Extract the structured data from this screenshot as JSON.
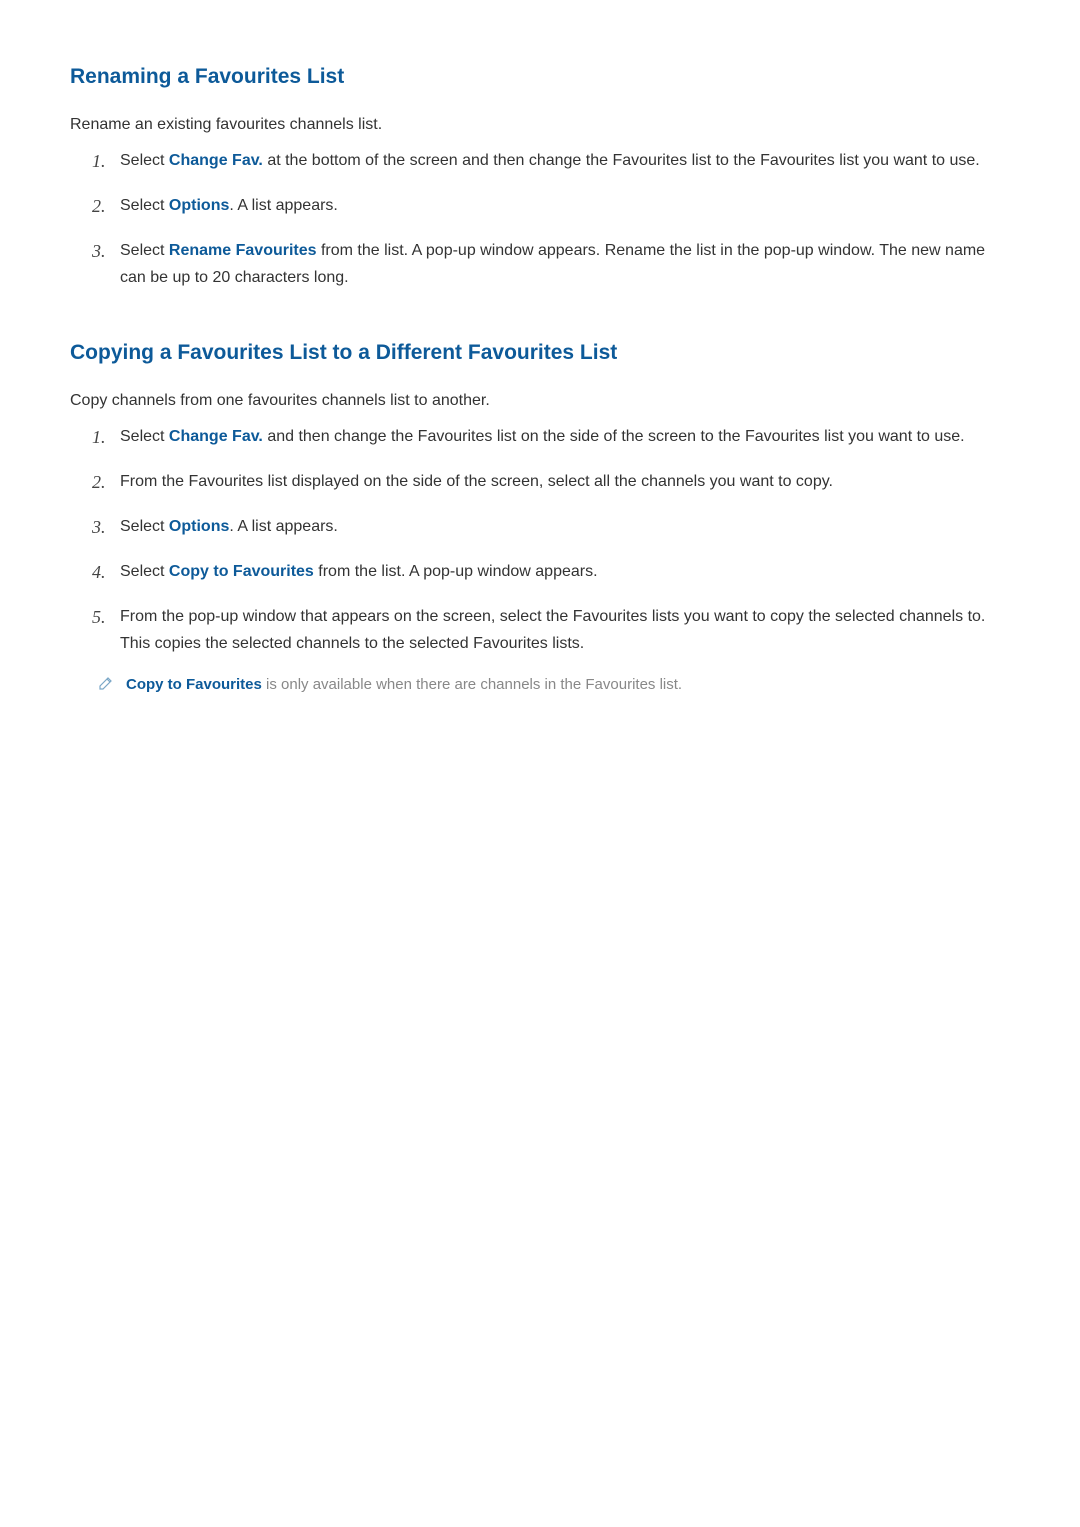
{
  "section1": {
    "heading": "Renaming a Favourites List",
    "intro": "Rename an existing favourites channels list.",
    "items": [
      {
        "number": "1.",
        "parts": [
          {
            "t": "Select ",
            "h": false
          },
          {
            "t": "Change Fav.",
            "h": true
          },
          {
            "t": " at the bottom of the screen and then change the Favourites list to the Favourites list you want to use.",
            "h": false
          }
        ]
      },
      {
        "number": "2.",
        "parts": [
          {
            "t": "Select ",
            "h": false
          },
          {
            "t": "Options",
            "h": true
          },
          {
            "t": ". A list appears.",
            "h": false
          }
        ]
      },
      {
        "number": "3.",
        "parts": [
          {
            "t": "Select ",
            "h": false
          },
          {
            "t": "Rename Favourites",
            "h": true
          },
          {
            "t": " from the list. A pop-up window appears. Rename the list in the pop-up window. The new name can be up to 20 characters long.",
            "h": false
          }
        ]
      }
    ]
  },
  "section2": {
    "heading": "Copying a Favourites List to a Different Favourites List",
    "intro": "Copy channels from one favourites channels list to another.",
    "items": [
      {
        "number": "1.",
        "parts": [
          {
            "t": "Select ",
            "h": false
          },
          {
            "t": "Change Fav.",
            "h": true
          },
          {
            "t": " and then change the Favourites list on the side of the screen to the Favourites list you want to use.",
            "h": false
          }
        ]
      },
      {
        "number": "2.",
        "parts": [
          {
            "t": "From the Favourites list displayed on the side of the screen, select all the channels you want to copy.",
            "h": false
          }
        ]
      },
      {
        "number": "3.",
        "parts": [
          {
            "t": "Select ",
            "h": false
          },
          {
            "t": "Options",
            "h": true
          },
          {
            "t": ". A list appears.",
            "h": false
          }
        ]
      },
      {
        "number": "4.",
        "parts": [
          {
            "t": "Select ",
            "h": false
          },
          {
            "t": "Copy to Favourites",
            "h": true
          },
          {
            "t": " from the list. A pop-up window appears.",
            "h": false
          }
        ]
      },
      {
        "number": "5.",
        "parts": [
          {
            "t": "From the pop-up window that appears on the screen, select the Favourites lists you want to copy the selected channels to. This copies the selected channels to the selected Favourites lists.",
            "h": false
          }
        ]
      }
    ],
    "note": {
      "parts": [
        {
          "t": "Copy to Favourites",
          "h": true
        },
        {
          "t": " is only available when there are channels in the Favourites list.",
          "h": false
        }
      ]
    }
  }
}
